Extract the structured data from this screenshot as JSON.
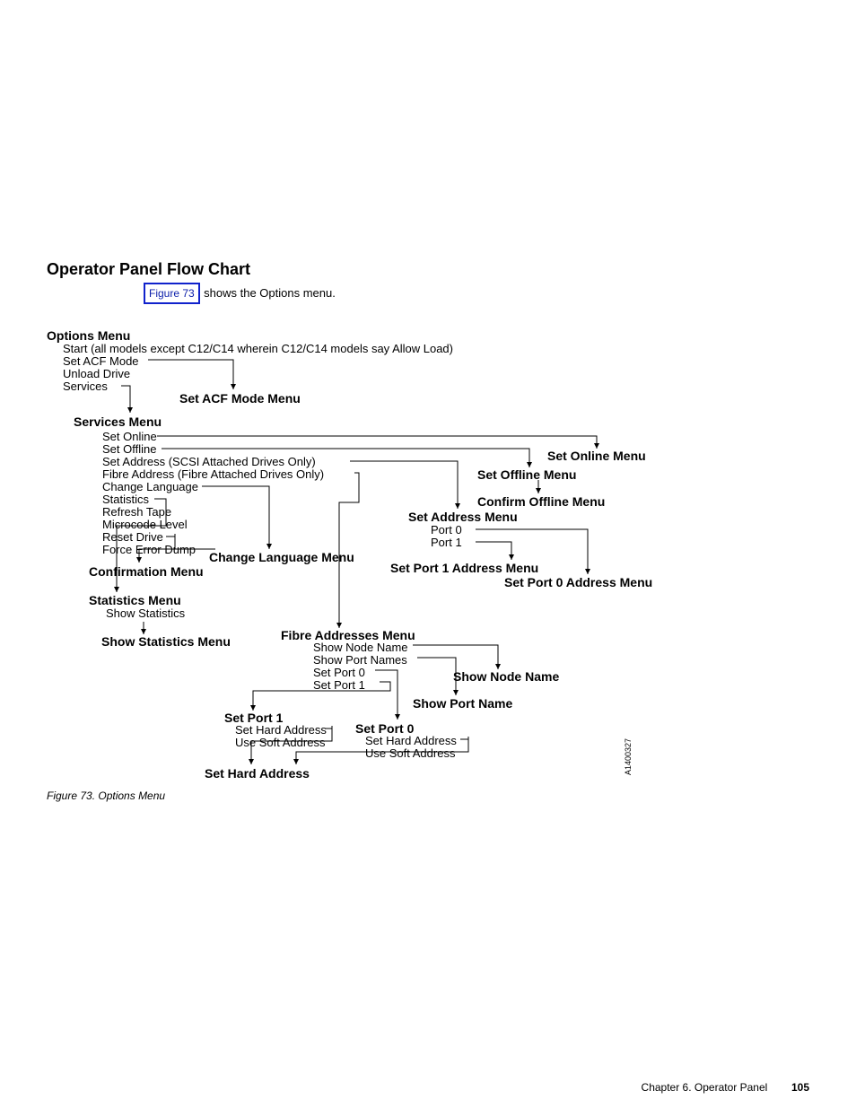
{
  "header": {
    "title": "Operator Panel Flow Chart",
    "intro_a": "Figure 73",
    "intro_b": " shows the Options menu."
  },
  "diagram": {
    "options_menu": "Options Menu",
    "opt_start": "Start (all models except C12/C14 wherein C12/C14 models say Allow Load)",
    "opt_set_acf": "Set ACF Mode",
    "opt_unload": "Unload Drive",
    "opt_services": "Services",
    "acf_mode_menu": "Set ACF Mode Menu",
    "services_menu": "Services  Menu",
    "svc_online": "Set Online",
    "svc_offline": "Set Offline",
    "svc_set_addr": "Set Address (SCSI Attached Drives Only)",
    "svc_fibre_addr": "Fibre Address (Fibre Attached Drives Only)",
    "svc_change_lang": "Change Language",
    "svc_statistics": "Statistics",
    "svc_refresh": "Refresh Tape",
    "svc_microcode": "Microcode Level",
    "svc_reset": "Reset Drive",
    "svc_force": "Force Error Dump",
    "set_online_menu": "Set Online  Menu",
    "set_offline_menu": "Set Offline  Menu",
    "confirm_offline_menu": "Confirm Offline Menu",
    "set_address_menu": "Set Address Menu",
    "sa_port0": "Port 0",
    "sa_port1": "Port 1",
    "set_port1_addr_menu": "Set Port 1 Address  Menu",
    "set_port0_addr_menu": "Set Port 0 Address  Menu",
    "change_lang_menu": "Change Language  Menu",
    "confirmation_menu": "Confirmation  Menu",
    "statistics_menu": "Statistics  Menu",
    "stats_show": "Show Statistics",
    "show_statistics_menu": "Show Statistics  Menu",
    "fibre_menu": "Fibre Addresses Menu",
    "fibre_show_node": "Show Node Name",
    "fibre_show_ports": "Show Port Names",
    "fibre_set_p0": "Set Port 0",
    "fibre_set_p1": "Set Port 1",
    "show_node_name": "Show Node Name",
    "show_port_name": "Show Port Name",
    "set_port1_label": "Set Port 1",
    "sp1_hard": "Set Hard Address",
    "sp1_soft": "Use Soft Address",
    "set_port0_label": "Set Port 0",
    "sp0_hard": "Set Hard Address",
    "sp0_soft": "Use Soft Address",
    "set_hard_addr": "Set Hard Address",
    "image_id": "A1400327"
  },
  "figure_caption": {
    "prefix": "Figure 73. ",
    "text": "Options Menu"
  },
  "footer": {
    "chapter": "Chapter 6. Operator Panel",
    "page": "105"
  }
}
